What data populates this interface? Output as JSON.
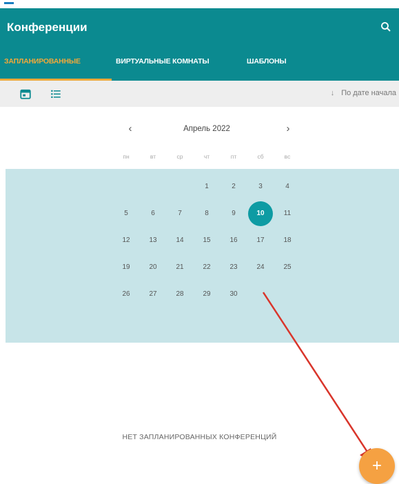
{
  "app": {
    "title": "Конференции"
  },
  "tabs": [
    {
      "label": "ЗАПЛАНИРОВАННЫЕ",
      "active": true
    },
    {
      "label": "ВИРТУАЛЬНЫЕ КОМНАТЫ",
      "active": false
    },
    {
      "label": "ШАБЛОНЫ",
      "active": false
    }
  ],
  "toolbar": {
    "sort_label": "По дате начала",
    "view_modes": [
      "calendar-icon",
      "list-icon"
    ]
  },
  "calendar": {
    "month_label": "Апрель 2022",
    "weekdays": [
      "пн",
      "вт",
      "ср",
      "чт",
      "пт",
      "сб",
      "вс"
    ],
    "days": [
      [
        "",
        "",
        "",
        "1",
        "2",
        "3",
        "4"
      ],
      [
        "5",
        "6",
        "7",
        "8",
        "9",
        "10",
        "11"
      ],
      [
        "12",
        "13",
        "14",
        "15",
        "16",
        "17",
        "18"
      ],
      [
        "19",
        "20",
        "21",
        "22",
        "23",
        "24",
        "25"
      ],
      [
        "26",
        "27",
        "28",
        "29",
        "30",
        "",
        ""
      ]
    ],
    "today": "10"
  },
  "empty_message": "НЕТ ЗАПЛАНИРОВАННЫХ КОНФЕРЕНЦИЙ",
  "fab": {
    "label": "+"
  },
  "colors": {
    "primary": "#0b8a90",
    "accent": "#f2a93a",
    "month_bg": "#c7e4e8",
    "annotation": "#d9352b"
  }
}
